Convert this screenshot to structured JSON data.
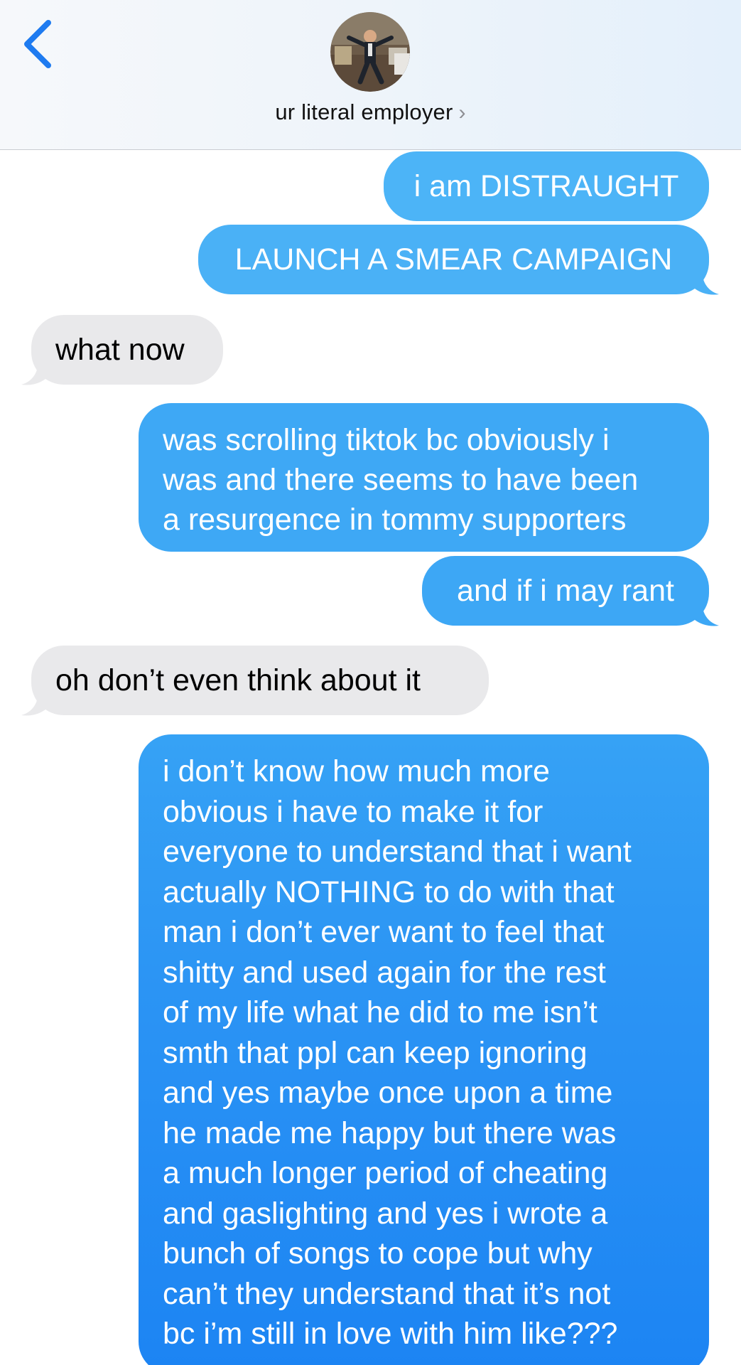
{
  "header": {
    "contact_name": "ur literal employer",
    "chevron": "›",
    "back_icon": "chevron-left-icon",
    "avatar_icon": "contact-photo"
  },
  "colors": {
    "sent_blue_light": "#4cb2f6",
    "sent_blue_mid": "#3ba4f5",
    "sent_blue_dark": "#1880f3",
    "received_gray": "#e9e9eb",
    "back_blue": "#1e7bf0"
  },
  "messages": [
    {
      "direction": "sent",
      "text": "i am DISTRAUGHT"
    },
    {
      "direction": "sent",
      "text": "LAUNCH A SMEAR CAMPAIGN"
    },
    {
      "direction": "received",
      "text": "what now"
    },
    {
      "direction": "sent",
      "lines": [
        "was scrolling tiktok bc obviously i",
        "was and there seems to have been",
        "a resurgence in tommy supporters"
      ]
    },
    {
      "direction": "sent",
      "text": "and if i may rant"
    },
    {
      "direction": "received",
      "text": "oh don’t even think about it"
    },
    {
      "direction": "sent",
      "lines": [
        "i don’t know how much more",
        "obvious i have to make it for",
        "everyone to understand that i want",
        "actually NOTHING to do with that",
        "man i don’t ever want to feel that",
        "shitty and used again for the rest",
        "of my life what he did to me isn’t",
        "smth that ppl can keep ignoring",
        "and yes maybe once upon a time",
        "he made me happy but there was",
        "a much longer period of cheating",
        "and gaslighting and yes i wrote a",
        "bunch of songs to cope but why",
        "can’t they understand that it’s not",
        "bc i’m still in love with him like???"
      ]
    }
  ]
}
